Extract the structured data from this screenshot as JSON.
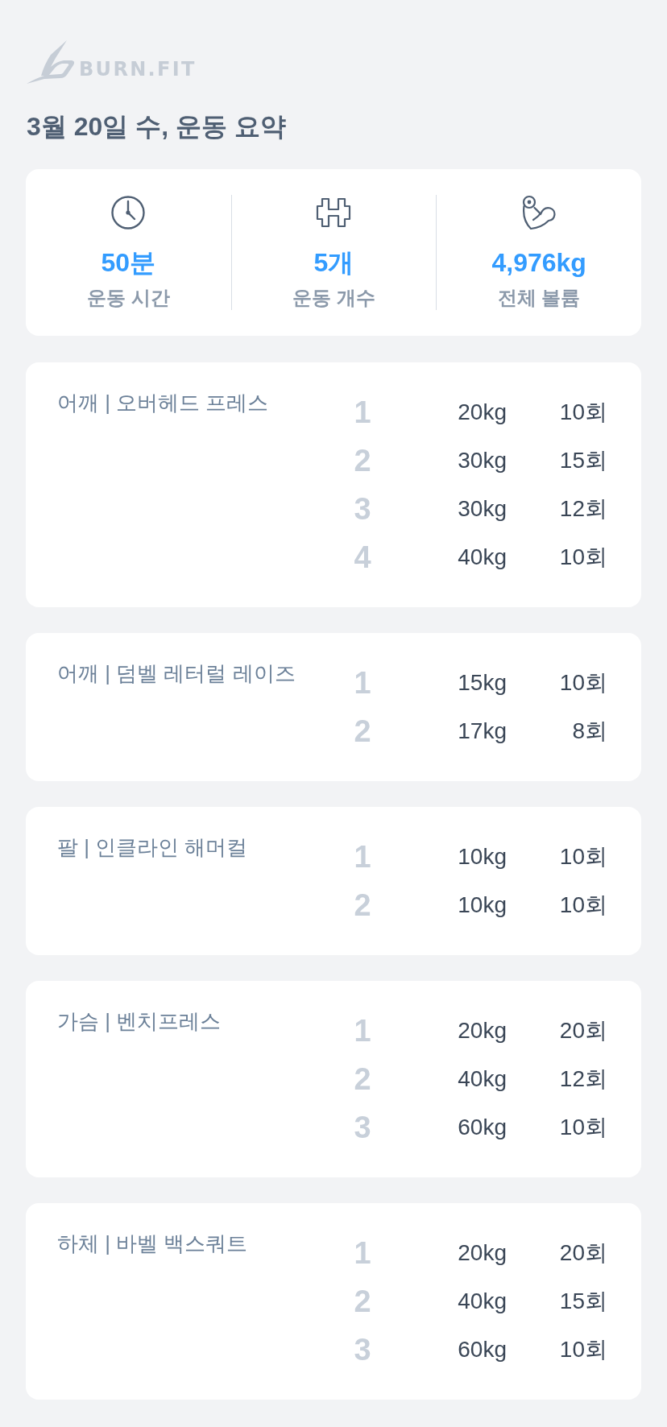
{
  "logo": {
    "text": "BURN.FIT"
  },
  "title": "3월 20일 수, 운동 요약",
  "summary": [
    {
      "kind": "clock",
      "value": "50분",
      "label": "운동 시간"
    },
    {
      "kind": "dumbbell",
      "value": "5개",
      "label": "운동 개수"
    },
    {
      "kind": "arm",
      "value": "4,976kg",
      "label": "전체 볼륨"
    }
  ],
  "exercises": [
    {
      "name": "어깨 | 오버헤드 프레스",
      "sets": [
        {
          "number": "1",
          "weight": "20kg",
          "reps": "10회"
        },
        {
          "number": "2",
          "weight": "30kg",
          "reps": "15회"
        },
        {
          "number": "3",
          "weight": "30kg",
          "reps": "12회"
        },
        {
          "number": "4",
          "weight": "40kg",
          "reps": "10회"
        }
      ]
    },
    {
      "name": "어깨 | 덤벨 레터럴 레이즈",
      "sets": [
        {
          "number": "1",
          "weight": "15kg",
          "reps": "10회"
        },
        {
          "number": "2",
          "weight": "17kg",
          "reps": "8회"
        }
      ]
    },
    {
      "name": "팔 | 인클라인 해머컬",
      "sets": [
        {
          "number": "1",
          "weight": "10kg",
          "reps": "10회"
        },
        {
          "number": "2",
          "weight": "10kg",
          "reps": "10회"
        }
      ]
    },
    {
      "name": "가슴 | 벤치프레스",
      "sets": [
        {
          "number": "1",
          "weight": "20kg",
          "reps": "20회"
        },
        {
          "number": "2",
          "weight": "40kg",
          "reps": "12회"
        },
        {
          "number": "3",
          "weight": "60kg",
          "reps": "10회"
        }
      ]
    },
    {
      "name": "하체 | 바벨 백스쿼트",
      "sets": [
        {
          "number": "1",
          "weight": "20kg",
          "reps": "20회"
        },
        {
          "number": "2",
          "weight": "40kg",
          "reps": "15회"
        },
        {
          "number": "3",
          "weight": "60kg",
          "reps": "10회"
        }
      ]
    }
  ]
}
